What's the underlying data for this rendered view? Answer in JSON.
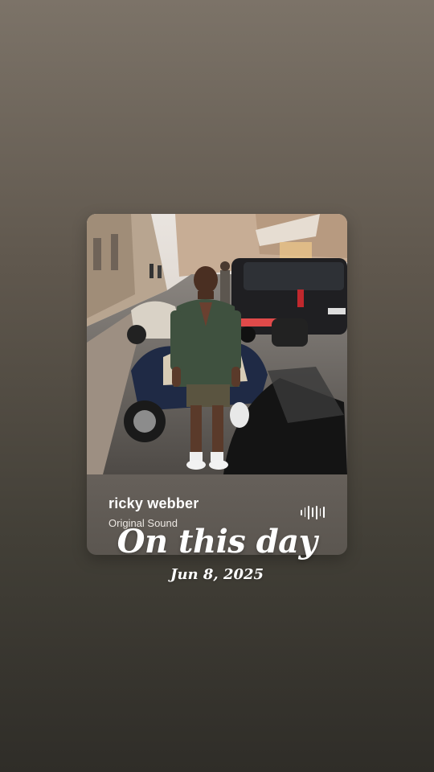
{
  "music_sticker": {
    "artist": "ricky webber",
    "track": "Original Sound",
    "icon": "audio-wave-icon"
  },
  "overlay": {
    "title": "On this day",
    "date": "Jun 8, 2025"
  },
  "colors": {
    "background_top": "#7c7368",
    "background_bottom": "#2f2d28",
    "sticker_info": "#5f5a54",
    "text": "#ffffff"
  }
}
